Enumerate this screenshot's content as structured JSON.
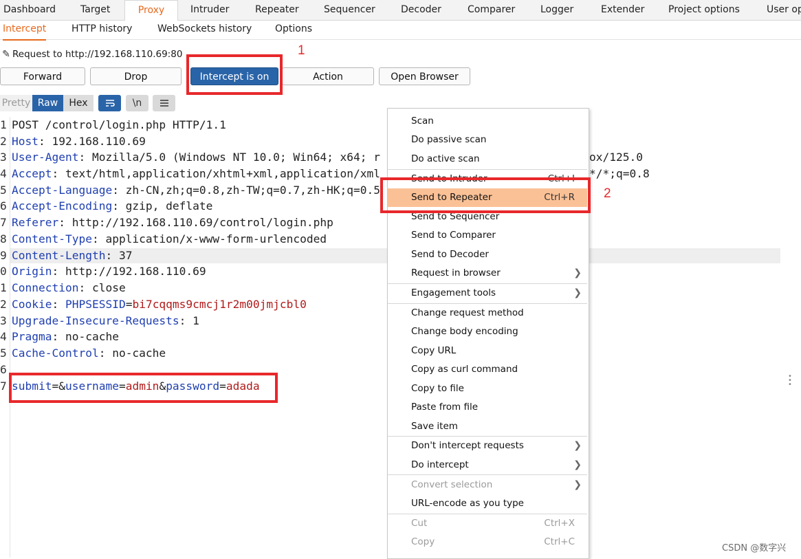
{
  "top_tabs": [
    {
      "label": "Dashboard"
    },
    {
      "label": "Target"
    },
    {
      "label": "Proxy"
    },
    {
      "label": "Intruder"
    },
    {
      "label": "Repeater"
    },
    {
      "label": "Sequencer"
    },
    {
      "label": "Decoder"
    },
    {
      "label": "Comparer"
    },
    {
      "label": "Logger"
    },
    {
      "label": "Extender"
    },
    {
      "label": "Project options"
    },
    {
      "label": "User op"
    }
  ],
  "sub_tabs": [
    {
      "label": "Intercept"
    },
    {
      "label": "HTTP history"
    },
    {
      "label": "WebSockets history"
    },
    {
      "label": "Options"
    }
  ],
  "request_line": "Request to http://192.168.110.69:80",
  "buttons": {
    "forward": "Forward",
    "drop": "Drop",
    "intercept": "Intercept is on",
    "action": "Action",
    "open_browser": "Open Browser"
  },
  "view_toggles": {
    "pretty": "Pretty",
    "raw": "Raw",
    "hex": "Hex",
    "newline": "\\n",
    "wrap_icon": "wrap-lines-icon",
    "menu_icon": "hamburger-menu-icon"
  },
  "annotations": {
    "one": "1",
    "two": "2"
  },
  "request_lines": [
    {
      "n": "1",
      "name": "",
      "sep": "",
      "value": "POST /control/login.php HTTP/1.1"
    },
    {
      "n": "2",
      "name": "Host",
      "sep": ":",
      "value": " 192.168.110.69"
    },
    {
      "n": "3",
      "name": "User-Agent",
      "sep": ":",
      "value": " Mozilla/5.0 (Windows NT 10.0; Win64; x64; r"
    },
    {
      "n": "4",
      "name": "Accept",
      "sep": ":",
      "value": " text/html,application/xhtml+xml,application/xml"
    },
    {
      "n": "5",
      "name": "Accept-Language",
      "sep": ":",
      "value": " zh-CN,zh;q=0.8,zh-TW;q=0.7,zh-HK;q=0.5"
    },
    {
      "n": "6",
      "name": "Accept-Encoding",
      "sep": ":",
      "value": " gzip, deflate"
    },
    {
      "n": "7",
      "name": "Referer",
      "sep": ":",
      "value": " http://192.168.110.69/control/login.php"
    },
    {
      "n": "8",
      "name": "Content-Type",
      "sep": ":",
      "value": " application/x-www-form-urlencoded"
    },
    {
      "n": "9",
      "name": "Content-Length",
      "sep": ":",
      "value": " 37"
    },
    {
      "n": "0",
      "name": "Origin",
      "sep": ":",
      "value": " http://192.168.110.69"
    },
    {
      "n": "1",
      "name": "Connection",
      "sep": ":",
      "value": " close"
    },
    {
      "n": "2",
      "name": "Cookie",
      "sep": ": ",
      "value": ""
    },
    {
      "n": "3",
      "name": "Upgrade-Insecure-Requests",
      "sep": ":",
      "value": " 1"
    },
    {
      "n": "4",
      "name": "Pragma",
      "sep": ":",
      "value": " no-cache"
    },
    {
      "n": "5",
      "name": "Cache-Control",
      "sep": ":",
      "value": " no-cache"
    },
    {
      "n": "6",
      "name": "",
      "sep": "",
      "value": ""
    }
  ],
  "cookie": {
    "name": "PHPSESSID",
    "eq": "=",
    "value": "bi7cqqms9cmcj1r2m00jmjcbl0"
  },
  "overflow_tails": {
    "ua_tail": "ox/125.0",
    "accept_tail": "*/*;q=0.8"
  },
  "body_line": {
    "n": "7",
    "k1": "submit",
    "e1": "=",
    "a1": "&",
    "k2": "username",
    "e2": "=",
    "v2": "admin",
    "a2": "&",
    "k3": "password",
    "e3": "=",
    "v3": "adada"
  },
  "context_menu": {
    "scan": "Scan",
    "passive_scan": "Do passive scan",
    "active_scan": "Do active scan",
    "send_intruder": "Send to Intruder",
    "send_intruder_sc": "Ctrl+I",
    "send_repeater": "Send to Repeater",
    "send_repeater_sc": "Ctrl+R",
    "send_sequencer": "Send to Sequencer",
    "send_comparer": "Send to Comparer",
    "send_decoder": "Send to Decoder",
    "request_in_browser": "Request in browser",
    "engagement_tools": "Engagement tools",
    "change_method": "Change request method",
    "change_encoding": "Change body encoding",
    "copy_url": "Copy URL",
    "copy_curl": "Copy as curl command",
    "copy_to_file": "Copy to file",
    "paste_from_file": "Paste from file",
    "save_item": "Save item",
    "dont_intercept": "Don't intercept requests",
    "do_intercept": "Do intercept",
    "convert_selection": "Convert selection",
    "url_encode": "URL-encode as you type",
    "cut": "Cut",
    "cut_sc": "Ctrl+X",
    "copy": "Copy",
    "copy_sc": "Ctrl+C"
  },
  "watermark": "CSDN @数字兴",
  "colors": {
    "accent": "#e8691d",
    "button_on": "#2a64a8",
    "highlight": "#fbc196",
    "annotation_red": "#e8282b"
  }
}
